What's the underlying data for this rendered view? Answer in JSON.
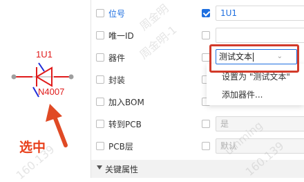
{
  "canvas": {
    "designator": "1U1",
    "part_number": "N4007",
    "annotation": "选中"
  },
  "properties": {
    "rows": [
      {
        "label": "位号",
        "checked": true,
        "value": "1U1"
      },
      {
        "label": "唯一ID",
        "checked": false,
        "value": ""
      },
      {
        "label": "器件",
        "checked": false,
        "value": "测试文本"
      },
      {
        "label": "封装",
        "checked": false,
        "value": ""
      },
      {
        "label": "加入BOM",
        "checked": false,
        "value": ""
      },
      {
        "label": "转到PCB",
        "checked": false,
        "value": "是"
      },
      {
        "label": "PCB层",
        "checked": false,
        "value": "默认"
      }
    ],
    "section_title": "关键属性"
  },
  "dropdown": {
    "items": [
      "设置为 \"测试文本\"",
      "添加器件..."
    ]
  },
  "watermarks": [
    "周金明",
    "周金明-1",
    "160.139",
    "160.139",
    "uinming"
  ]
}
